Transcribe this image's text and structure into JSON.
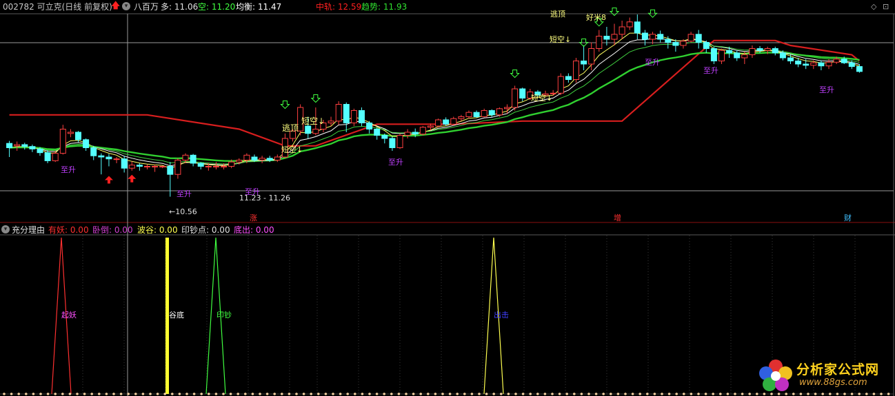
{
  "header": {
    "title": "002782 可立克(日线 前复权)",
    "indicator_name": "八百万",
    "duo_label": "多: 11.06",
    "kong_label": "空: 11.20",
    "junheng_label": "均衡: 11.47",
    "zhonggui_label": "中轨: 12.59",
    "qushi_label": "趋势: 11.93"
  },
  "sub_header": {
    "name": "充分理由",
    "items": [
      {
        "label": "有妖: 0.00",
        "color": "#ff3030"
      },
      {
        "label": "卧倒: 0.00",
        "color": "#d040d0"
      },
      {
        "label": "波谷: 0.00",
        "color": "#ffff50"
      },
      {
        "label": "印钞点: 0.00",
        "color": "#e0e0e0"
      },
      {
        "label": "底出: 0.00",
        "color": "#ff50ff"
      }
    ]
  },
  "annotations": {
    "low_label": "10.56",
    "range_label": "11.23 - 11.26",
    "taozou": "逃顶",
    "duankong": "短空",
    "zhisheng": "至升",
    "haomi": "好米8",
    "top_cut": "逃顶"
  },
  "date_marks": [
    "涨",
    "增",
    "财"
  ],
  "sub_labels": {
    "yao": "起妖",
    "gudi": "谷底",
    "yinchao": "印钞",
    "chuji": "出击"
  },
  "watermark": {
    "name": "分析家公式网",
    "url": "www.88gs.com"
  },
  "colors": {
    "up": "#ff4040",
    "down": "#54ffff",
    "zhonggui": "#d81e1e",
    "qushi": "#30d030",
    "ma": "#ffffff",
    "bg": "#000000"
  },
  "chart_data": {
    "type": "candlestick",
    "price_range": [
      10.4,
      13.4
    ],
    "candles": [
      [
        11.42,
        11.35,
        11.46,
        11.2
      ],
      [
        11.38,
        11.4,
        11.45,
        11.3
      ],
      [
        11.4,
        11.37,
        11.43,
        11.32
      ],
      [
        11.37,
        11.33,
        11.4,
        11.28
      ],
      [
        11.33,
        11.27,
        11.36,
        11.22
      ],
      [
        11.27,
        11.14,
        11.31,
        11.1
      ],
      [
        11.14,
        11.26,
        11.3,
        11.12
      ],
      [
        11.26,
        11.65,
        11.72,
        11.24
      ],
      [
        11.58,
        11.6,
        11.65,
        11.52
      ],
      [
        11.6,
        11.48,
        11.62,
        11.44
      ],
      [
        11.48,
        11.35,
        11.5,
        11.3
      ],
      [
        11.35,
        11.22,
        11.38,
        11.15
      ],
      [
        11.22,
        11.2,
        11.26,
        10.92
      ],
      [
        11.2,
        11.17,
        11.25,
        11.05
      ],
      [
        11.17,
        11.17,
        11.2,
        11.1
      ],
      [
        11.17,
        11.02,
        11.22,
        10.95
      ],
      [
        11.02,
        11.07,
        11.13,
        10.98
      ],
      [
        11.07,
        11.05,
        11.1,
        10.98
      ],
      [
        11.05,
        11.05,
        11.08,
        11.0
      ],
      [
        11.05,
        11.05,
        11.08,
        10.96
      ],
      [
        11.05,
        11.05,
        11.06,
        11.02
      ],
      [
        11.05,
        10.92,
        11.12,
        10.56
      ],
      [
        10.92,
        11.15,
        11.18,
        10.85
      ],
      [
        11.15,
        11.23,
        11.26,
        11.1
      ],
      [
        11.23,
        11.1,
        11.25,
        11.05
      ],
      [
        11.1,
        11.05,
        11.12,
        11.0
      ],
      [
        11.05,
        11.05,
        11.1,
        10.98
      ],
      [
        11.05,
        11.05,
        11.12,
        11.0
      ],
      [
        11.05,
        11.05,
        11.1,
        11.0
      ],
      [
        11.05,
        11.12,
        11.16,
        11.02
      ],
      [
        11.12,
        11.15,
        11.18,
        11.08
      ],
      [
        11.15,
        11.23,
        11.26,
        11.1
      ],
      [
        11.2,
        11.15,
        11.24,
        11.12
      ],
      [
        11.15,
        11.18,
        11.22,
        11.1
      ],
      [
        11.18,
        11.15,
        11.22,
        11.12
      ],
      [
        11.15,
        11.2,
        11.24,
        11.12
      ],
      [
        11.2,
        11.5,
        11.58,
        11.18
      ],
      [
        11.5,
        11.62,
        11.65,
        11.45
      ],
      [
        11.62,
        12.0,
        12.05,
        11.55
      ],
      [
        11.7,
        11.58,
        11.85,
        11.5
      ],
      [
        11.58,
        11.65,
        12.0,
        11.55
      ],
      [
        11.65,
        11.75,
        11.8,
        11.6
      ],
      [
        11.75,
        11.78,
        11.85,
        11.7
      ],
      [
        11.78,
        12.05,
        12.1,
        11.72
      ],
      [
        12.05,
        11.75,
        12.08,
        11.6
      ],
      [
        11.75,
        11.95,
        11.98,
        11.7
      ],
      [
        11.95,
        11.75,
        12.0,
        11.7
      ],
      [
        11.75,
        11.65,
        11.78,
        11.58
      ],
      [
        11.65,
        11.55,
        11.68,
        11.48
      ],
      [
        11.55,
        11.5,
        11.58,
        11.42
      ],
      [
        11.5,
        11.35,
        11.53,
        11.3
      ],
      [
        11.35,
        11.55,
        11.58,
        11.33
      ],
      [
        11.55,
        11.6,
        11.65,
        11.5
      ],
      [
        11.6,
        11.57,
        11.66,
        11.52
      ],
      [
        11.57,
        11.68,
        11.7,
        11.55
      ],
      [
        11.68,
        11.7,
        11.74,
        11.63
      ],
      [
        11.7,
        11.8,
        11.82,
        11.68
      ],
      [
        11.8,
        11.73,
        11.84,
        11.7
      ],
      [
        11.73,
        11.82,
        11.85,
        11.71
      ],
      [
        11.82,
        11.85,
        11.88,
        11.78
      ],
      [
        11.85,
        11.92,
        11.95,
        11.82
      ],
      [
        11.92,
        11.85,
        11.95,
        11.83
      ],
      [
        11.85,
        11.95,
        11.98,
        11.84
      ],
      [
        11.95,
        11.88,
        11.97,
        11.85
      ],
      [
        11.88,
        11.98,
        12.0,
        11.85
      ],
      [
        11.98,
        12.0,
        12.05,
        11.9
      ],
      [
        12.0,
        12.3,
        12.35,
        11.95
      ],
      [
        12.3,
        12.15,
        12.32,
        12.1
      ],
      [
        12.15,
        12.25,
        12.3,
        12.12
      ],
      [
        12.25,
        12.2,
        12.28,
        12.17
      ],
      [
        12.2,
        12.22,
        12.27,
        12.18
      ],
      [
        12.22,
        12.23,
        12.28,
        12.19
      ],
      [
        12.23,
        12.5,
        12.55,
        12.2
      ],
      [
        12.5,
        12.45,
        12.55,
        12.4
      ],
      [
        12.45,
        12.75,
        12.8,
        12.4
      ],
      [
        12.75,
        12.7,
        13.0,
        12.6
      ],
      [
        12.7,
        12.95,
        13.05,
        12.6
      ],
      [
        12.95,
        13.15,
        13.25,
        12.9
      ],
      [
        13.15,
        13.1,
        13.3,
        13.0
      ],
      [
        13.1,
        13.18,
        13.35,
        13.0
      ],
      [
        13.18,
        13.3,
        13.4,
        13.1
      ],
      [
        13.3,
        13.38,
        13.45,
        13.25
      ],
      [
        13.38,
        13.2,
        13.5,
        13.1
      ],
      [
        13.2,
        13.1,
        13.25,
        13.0
      ],
      [
        13.1,
        13.18,
        13.22,
        13.02
      ],
      [
        13.18,
        13.1,
        13.24,
        13.05
      ],
      [
        13.1,
        13.05,
        13.15,
        12.95
      ],
      [
        13.05,
        13.0,
        13.1,
        12.9
      ],
      [
        13.0,
        13.07,
        13.1,
        12.95
      ],
      [
        13.07,
        13.18,
        13.22,
        13.05
      ],
      [
        13.18,
        13.05,
        13.25,
        12.95
      ],
      [
        13.05,
        12.95,
        13.08,
        12.88
      ],
      [
        12.95,
        12.75,
        12.98,
        12.7
      ],
      [
        12.75,
        12.92,
        12.95,
        12.7
      ],
      [
        12.92,
        12.88,
        12.98,
        12.8
      ],
      [
        12.88,
        12.8,
        12.92,
        12.75
      ],
      [
        12.8,
        12.85,
        12.9,
        12.7
      ],
      [
        12.85,
        12.95,
        13.0,
        12.8
      ],
      [
        12.95,
        12.92,
        12.99,
        12.88
      ],
      [
        12.92,
        12.95,
        12.98,
        12.86
      ],
      [
        12.95,
        12.88,
        12.98,
        12.84
      ],
      [
        12.88,
        12.8,
        12.92,
        12.76
      ],
      [
        12.8,
        12.75,
        12.85,
        12.7
      ],
      [
        12.75,
        12.7,
        12.8,
        12.65
      ],
      [
        12.7,
        12.68,
        12.78,
        12.62
      ],
      [
        12.68,
        12.72,
        12.76,
        12.62
      ],
      [
        12.72,
        12.67,
        12.76,
        12.6
      ],
      [
        12.67,
        12.73,
        12.78,
        12.62
      ],
      [
        12.73,
        12.78,
        12.82,
        12.7
      ],
      [
        12.78,
        12.72,
        12.82,
        12.7
      ],
      [
        12.72,
        12.66,
        12.76,
        12.62
      ],
      [
        12.66,
        12.58,
        12.7,
        12.56
      ]
    ]
  }
}
